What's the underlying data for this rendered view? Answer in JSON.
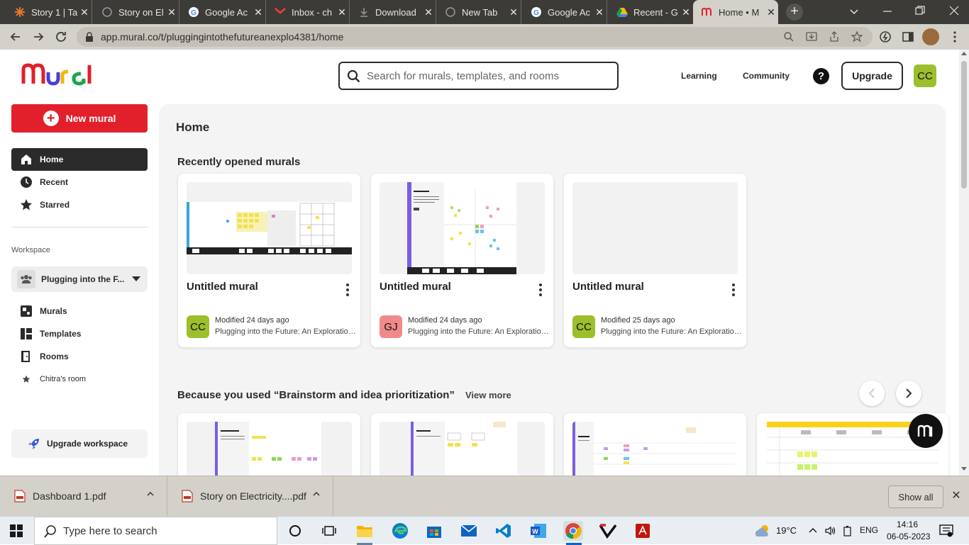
{
  "browser": {
    "tabs": [
      {
        "title": "Story 1 | Ta",
        "icon": "tableau-icon",
        "active": false
      },
      {
        "title": "Story on El",
        "icon": "globe-icon",
        "active": false
      },
      {
        "title": "Google Ac",
        "icon": "google-icon",
        "active": false
      },
      {
        "title": "Inbox - ch",
        "icon": "gmail-icon",
        "active": false
      },
      {
        "title": "Download",
        "icon": "download-icon",
        "active": false
      },
      {
        "title": "New Tab",
        "icon": "globe-icon",
        "active": false
      },
      {
        "title": "Google Ac",
        "icon": "google-icon",
        "active": false
      },
      {
        "title": "Recent - G",
        "icon": "google-drive-icon",
        "active": false
      },
      {
        "title": "Home • M",
        "icon": "mural-icon",
        "active": true
      }
    ],
    "url": "app.mural.co/t/pluggingintothefutureanexplo4381/home"
  },
  "header": {
    "logo": "Mural",
    "search_placeholder": "Search for murals, templates, and rooms",
    "nav": [
      "Learning",
      "Community"
    ],
    "help": "?",
    "upgrade": "Upgrade",
    "avatar": "CC"
  },
  "sidebar": {
    "new_mural": "New mural",
    "items": [
      {
        "label": "Home",
        "icon": "home-icon"
      },
      {
        "label": "Recent",
        "icon": "clock-icon"
      },
      {
        "label": "Starred",
        "icon": "star-icon"
      }
    ],
    "workspace_label": "Workspace",
    "workspace_name": "Plugging into the F...",
    "workspace_items": [
      {
        "label": "Murals",
        "icon": "murals-icon"
      },
      {
        "label": "Templates",
        "icon": "templates-icon"
      },
      {
        "label": "Rooms",
        "icon": "rooms-icon"
      }
    ],
    "room": "Chitra's room",
    "upgrade_workspace": "Upgrade workspace"
  },
  "main": {
    "title": "Home",
    "recent_title": "Recently opened murals",
    "murals": [
      {
        "title": "Untitled mural",
        "avatar": "CC",
        "avatar_color": "#9cbf2b",
        "modified": "Modified 24 days ago",
        "workspace": "Plugging into the Future: An Exploration of Electricity"
      },
      {
        "title": "Untitled mural",
        "avatar": "GJ",
        "avatar_color": "#f08a8a",
        "modified": "Modified 24 days ago",
        "workspace": "Plugging into the Future: An Exploration of Electricity"
      },
      {
        "title": "Untitled mural",
        "avatar": "CC",
        "avatar_color": "#9cbf2b",
        "modified": "Modified 25 days ago",
        "workspace": "Plugging into the Future: An Exploration of Electricity"
      }
    ],
    "because_title": "Because you used  “Brainstorm and idea prioritization”",
    "view_more": "View more"
  },
  "downloads": {
    "items": [
      "Dashboard 1.pdf",
      "Story on Electricity....pdf"
    ],
    "show_all": "Show all"
  },
  "taskbar": {
    "search_placeholder": "Type here to search",
    "weather": "19°C",
    "lang": "ENG",
    "time": "14:16",
    "date": "06-05-2023"
  }
}
